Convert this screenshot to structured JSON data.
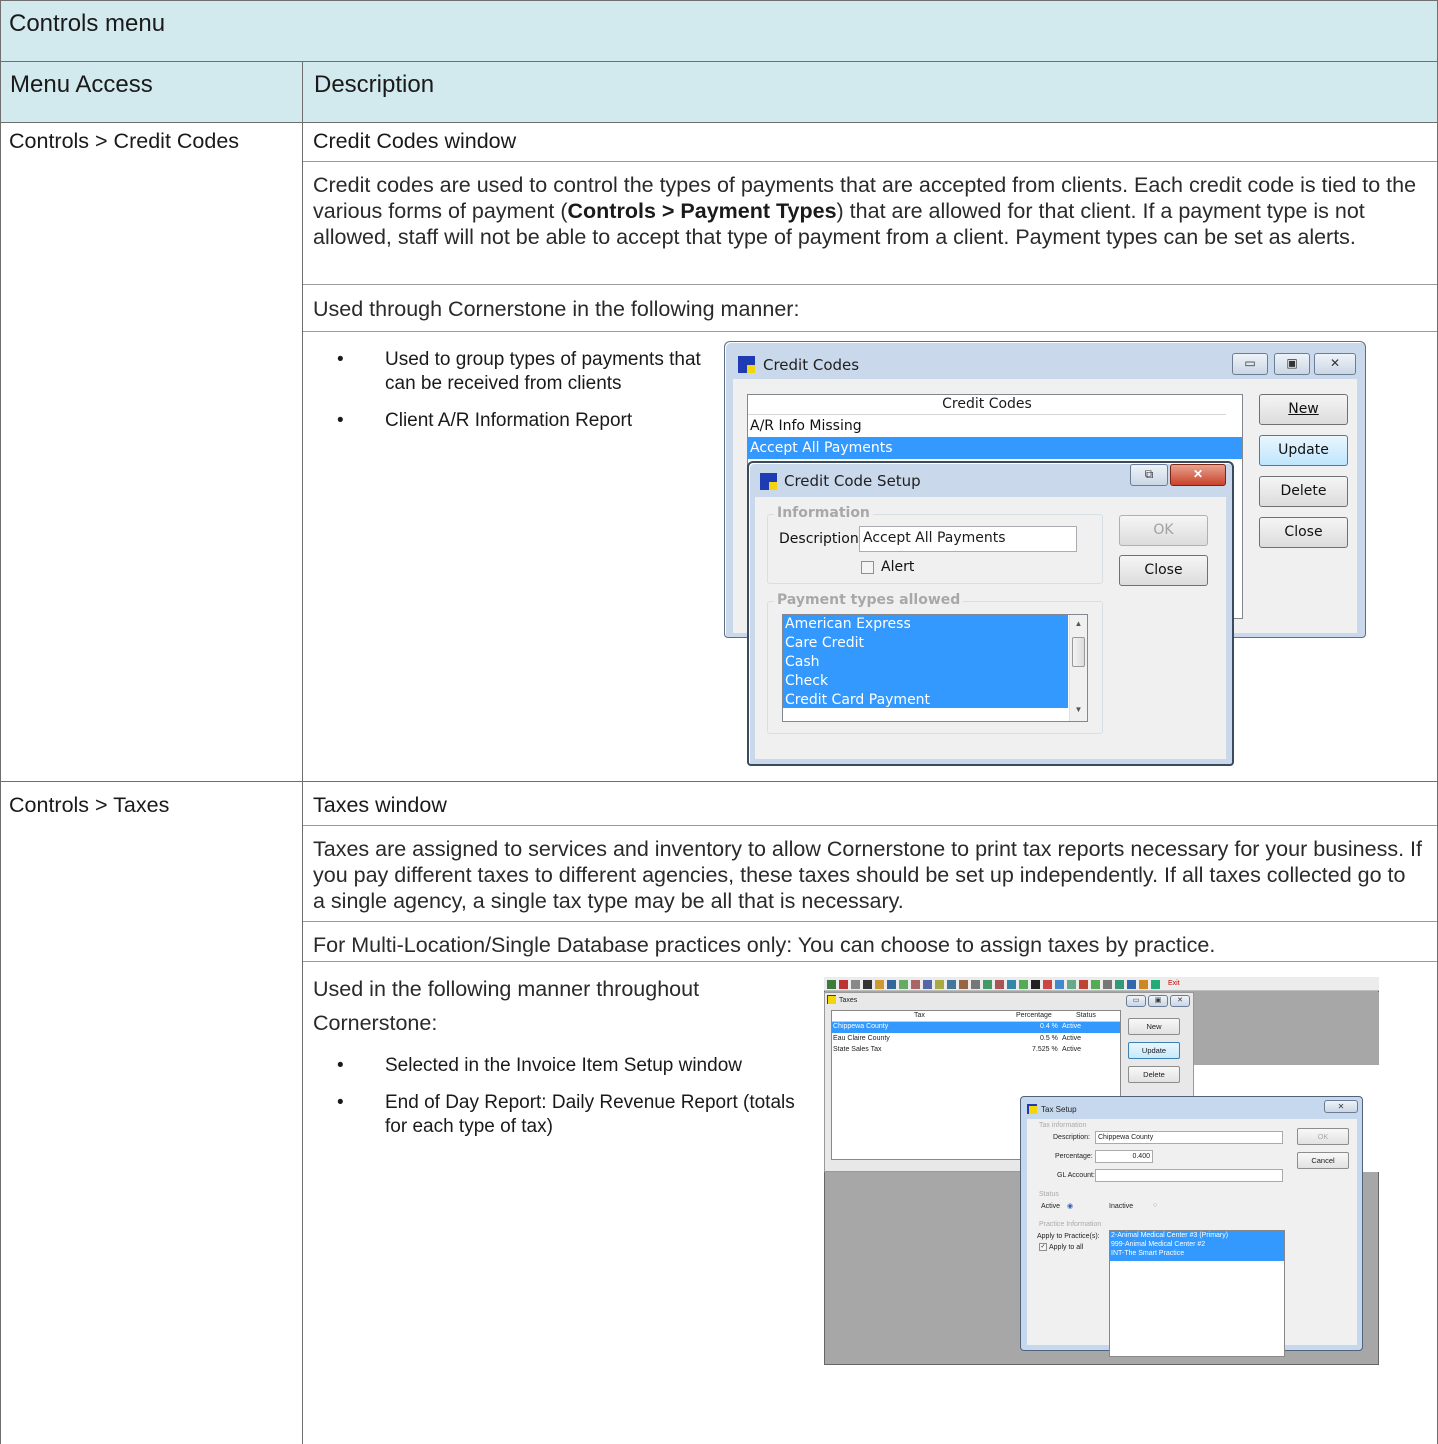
{
  "header": {
    "title": "Controls menu",
    "col_menu": "Menu Access",
    "col_desc": "Description"
  },
  "credit_codes": {
    "menu": "Controls > Credit Codes",
    "title": "Credit Codes window",
    "para1_a": "Credit codes are used to control the types of payments that are accepted from clients. Each credit code is tied to the various forms of payment (",
    "para1_b": "Controls > Payment Types",
    "para1_c": ") that are allowed for that client. If a payment type is not allowed, staff will not be able to accept that type of payment from a client. Payment types can be set as alerts.",
    "para2": "Used through Cornerstone in the following manner:",
    "bullets": [
      "Used to group types of payments that can be received from clients",
      "Client A/R Information Report"
    ],
    "window": {
      "title": "Credit Codes",
      "column_header": "Credit Codes",
      "rows": [
        "A/R Info Missing",
        "Accept All Payments"
      ],
      "buttons": {
        "new": "New",
        "update": "Update",
        "delete": "Delete",
        "close": "Close"
      }
    },
    "setup": {
      "title": "Credit Code Setup",
      "group_info": "Information",
      "desc_label": "Description:",
      "desc_value": "Accept All Payments",
      "alert_label": "Alert",
      "ok": "OK",
      "close": "Close",
      "group_payments": "Payment types allowed",
      "payments": [
        "American Express",
        "Care Credit",
        "Cash",
        "Check",
        "Credit Card Payment"
      ]
    }
  },
  "taxes": {
    "menu": "Controls > Taxes",
    "title": "Taxes window",
    "para1": "Taxes are assigned to services and inventory to allow Cornerstone to print tax reports necessary for your business. If you pay different taxes to different agencies, these taxes should be set up independently. If all taxes collected go to a single agency, a single tax type may be all that is necessary.",
    "para2": "For Multi-Location/Single Database practices only: You can choose to assign taxes by practice.",
    "para3a": "Used in the following manner throughout",
    "para3b": "Cornerstone:",
    "bullets": [
      "Selected in the Invoice Item Setup window",
      "End of Day Report: Daily Revenue Report (totals for each type of tax)"
    ],
    "window": {
      "title": "Taxes",
      "toolbar_exit": "Exit",
      "col_tax": "Tax",
      "col_pct": "Percentage",
      "col_status": "Status",
      "rows": [
        {
          "tax": "Chippewa County",
          "pct": "0.4 %",
          "status": "Active"
        },
        {
          "tax": "Eau Claire County",
          "pct": "0.5 %",
          "status": "Active"
        },
        {
          "tax": "State Sales Tax",
          "pct": "7.525 %",
          "status": "Active"
        }
      ],
      "buttons": {
        "new": "New",
        "update": "Update",
        "delete": "Delete"
      }
    },
    "setup": {
      "title": "Tax Setup",
      "group_info": "Tax information",
      "desc_label": "Description:",
      "desc_value": "Chippewa County",
      "pct_label": "Percentage:",
      "pct_value": "0.400",
      "gl_label": "GL Account:",
      "gl_value": "",
      "group_status": "Status",
      "active": "Active",
      "inactive": "Inactive",
      "group_practice": "Practice Information",
      "apply_label": "Apply to Practice(s):",
      "apply_all": "Apply to all",
      "practices": [
        "2-Animal Medical Center #3 (Primary)",
        "999-Animal Medical Center #2",
        "INT-The Smart Practice"
      ],
      "ok": "OK",
      "cancel": "Cancel"
    }
  },
  "colors": {
    "header_bg": "#d2e9ee",
    "selection": "#3399ff",
    "border": "#6f6f6f"
  }
}
